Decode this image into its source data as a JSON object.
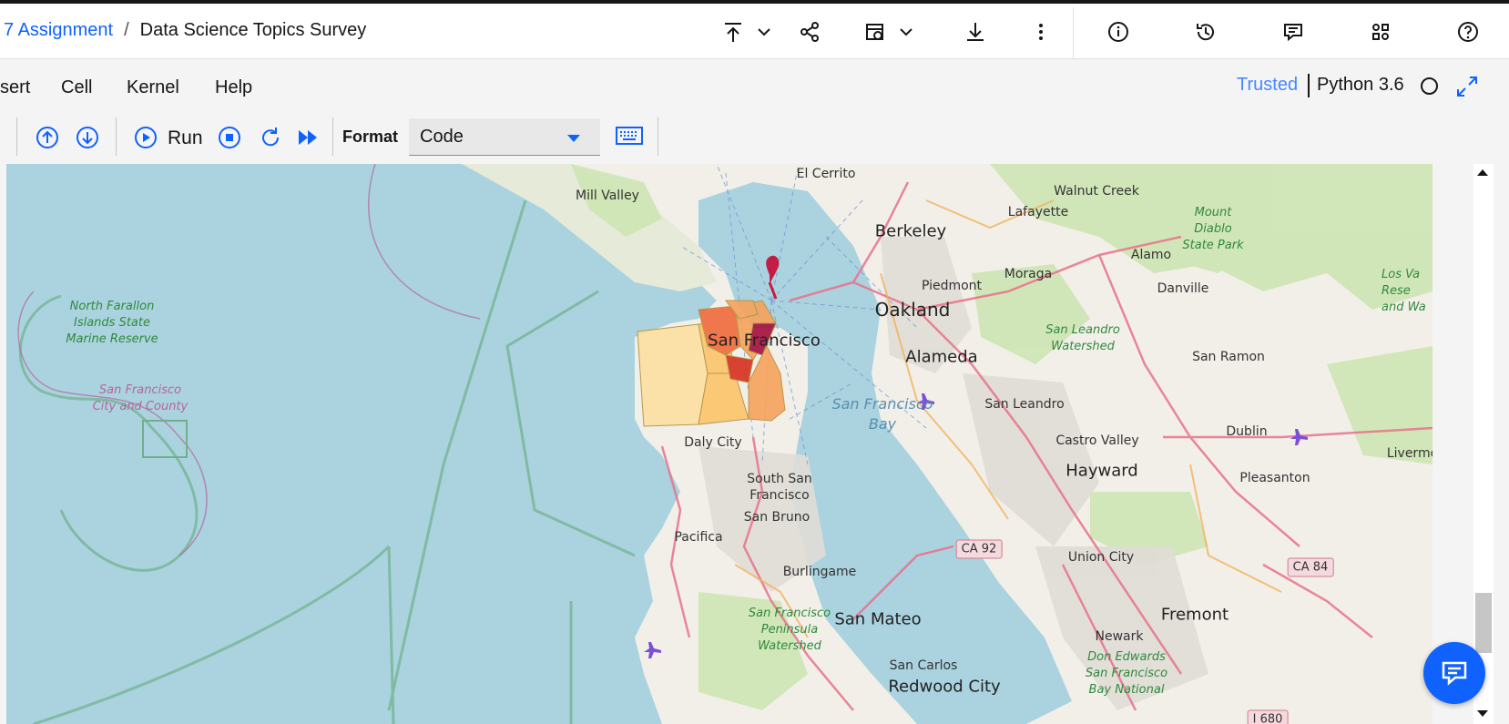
{
  "header": {
    "breadcrumb_project": "7 Assignment",
    "breadcrumb_separator": "/",
    "breadcrumb_notebook": "Data Science Topics Survey",
    "icons": [
      "publish-icon",
      "chevron-down-icon",
      "share-icon",
      "schedule-icon",
      "chevron-down-icon",
      "download-icon",
      "overflow-menu-icon",
      "info-icon",
      "version-history-icon",
      "comments-icon",
      "find-replace-icon",
      "help-icon"
    ]
  },
  "menubar": {
    "items": [
      "sert",
      "Cell",
      "Kernel",
      "Help"
    ],
    "trusted": "Trusted",
    "kernel_name": "Python 3.6"
  },
  "toolbar": {
    "run_label": "Run",
    "format_label": "Format",
    "format_value": "Code"
  },
  "map": {
    "labels": {
      "el_cerrito": "El Cerrito",
      "walnut_creek": "Walnut Creek",
      "mill_valley": "Mill Valley",
      "lafayette": "Lafayette",
      "mount_diablo": "Mount Diablo State Park",
      "berkeley": "Berkeley",
      "alamo": "Alamo",
      "moraga": "Moraga",
      "danville": "Danville",
      "los_va": "Los Va Rese and Wa",
      "piedmont": "Piedmont",
      "north_farallon": "North Farallon Islands State Marine Reserve",
      "oakland": "Oakland",
      "san_leandro_watershed": "San Leandro Watershed",
      "san_francisco": "San Francisco",
      "alameda": "Alameda",
      "san_ramon": "San Ramon",
      "sf_city_county": "San Francisco City and County",
      "sf_bay": "San Francisco Bay",
      "san_leandro": "San Leandro",
      "dublin": "Dublin",
      "daly_city": "Daly City",
      "castro_valley": "Castro Valley",
      "livermore": "Livermo",
      "hayward": "Hayward",
      "pleasanton": "Pleasanton",
      "south_sf": "South San Francisco",
      "san_bruno": "San Bruno",
      "pacifica": "Pacifica",
      "union_city": "Union City",
      "burlingame": "Burlingame",
      "fremont": "Fremont",
      "sf_peninsula_watershed": "San Francisco Peninsula Watershed",
      "san_mateo": "San Mateo",
      "newark": "Newark",
      "don_edwards": "Don Edwards San Francisco Bay National",
      "san_carlos": "San Carlos",
      "redwood_city": "Redwood City"
    },
    "shields": {
      "ca92": "CA 92",
      "ca84": "CA 84",
      "i680": "I 680"
    },
    "choropleth_colors": [
      "#fde0a0",
      "#fcc46a",
      "#f7a35c",
      "#ef6b3b",
      "#d7301f",
      "#a50f3e"
    ]
  },
  "colors": {
    "accent": "#0f62fe",
    "trusted": "#4589ff",
    "water": "#aad3df",
    "land": "#f2efe9",
    "park": "#cde6b4"
  }
}
